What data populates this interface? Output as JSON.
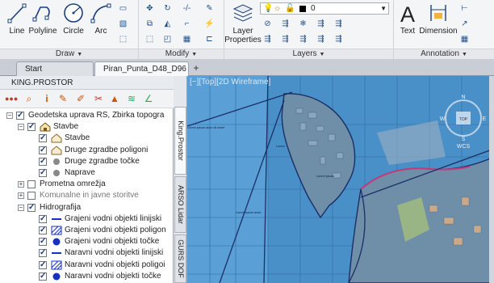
{
  "ribbon": {
    "draw": {
      "title": "Draw",
      "tools": [
        {
          "label": "Line",
          "icon": "line-icon"
        },
        {
          "label": "Polyline",
          "icon": "polyline-icon"
        },
        {
          "label": "Circle",
          "icon": "circle-icon"
        },
        {
          "label": "Arc",
          "icon": "arc-icon"
        }
      ]
    },
    "modify": {
      "title": "Modify"
    },
    "layers": {
      "title": "Layers",
      "layer_properties_label": "Layer Properties",
      "current_layer_value": "0"
    },
    "annotation": {
      "title": "Annotation",
      "text_label": "Text",
      "dimension_label": "Dimension"
    }
  },
  "tabs": [
    {
      "label": "Start",
      "active": false
    },
    {
      "label": "Piran_Punta_D48_D96",
      "active": true
    }
  ],
  "left_panel": {
    "title": "KING.PROSTOR",
    "tree": [
      {
        "label": "Geodetska uprava RS, Zbirka topogra",
        "level": 0,
        "expander": "−",
        "checked": true,
        "icon": "folder-icon"
      },
      {
        "label": "Stavbe",
        "level": 1,
        "expander": "−",
        "checked": true,
        "icon": "buildings-icon"
      },
      {
        "label": "Stavbe",
        "level": 2,
        "expander": "",
        "checked": true,
        "icon": "house-icon"
      },
      {
        "label": "Druge zgradbe poligoni",
        "level": 2,
        "expander": "",
        "checked": true,
        "icon": "house-icon"
      },
      {
        "label": "Druge zgradbe točke",
        "level": 2,
        "expander": "",
        "checked": true,
        "icon": "dot-icon"
      },
      {
        "label": "Naprave",
        "level": 2,
        "expander": "",
        "checked": true,
        "icon": "dot-icon"
      },
      {
        "label": "Prometna omrežja",
        "level": 1,
        "expander": "+",
        "checked": false,
        "icon": ""
      },
      {
        "label": "Komunalne in javne storitve",
        "level": 1,
        "expander": "+",
        "checked": false,
        "icon": "",
        "grey": true
      },
      {
        "label": "Hidrografija",
        "level": 1,
        "expander": "−",
        "checked": true,
        "icon": ""
      },
      {
        "label": "Grajeni vodni objekti linijski",
        "level": 2,
        "expander": "",
        "checked": true,
        "icon": "blue-line-icon"
      },
      {
        "label": "Grajeni vodni objekti poligon",
        "level": 2,
        "expander": "",
        "checked": true,
        "icon": "hatch-icon"
      },
      {
        "label": "Grajeni vodni objekti točke",
        "level": 2,
        "expander": "",
        "checked": true,
        "icon": "blue-dot-icon"
      },
      {
        "label": "Naravni vodni objekti linijski",
        "level": 2,
        "expander": "",
        "checked": true,
        "icon": "blue-line-icon"
      },
      {
        "label": "Naravni vodni objekti poligoi",
        "level": 2,
        "expander": "",
        "checked": true,
        "icon": "hatch-icon"
      },
      {
        "label": "Naravni vodni objekti točke",
        "level": 2,
        "expander": "",
        "checked": true,
        "icon": "blue-dot-icon"
      }
    ]
  },
  "side_tabs": [
    "King.Prostor",
    "ARSO Lidar",
    "GURS DOF"
  ],
  "viewport": {
    "label": "[−][Top][2D Wireframe]",
    "compass": {
      "top": "TOP",
      "north": "N",
      "south": "S",
      "east": "E",
      "west": "W",
      "wcs": "WCS"
    }
  },
  "colors": {
    "sea": "#4a90c8",
    "land": "#6f8ea8",
    "coast": "#1b2f66",
    "highlight": "#c23a7c"
  }
}
